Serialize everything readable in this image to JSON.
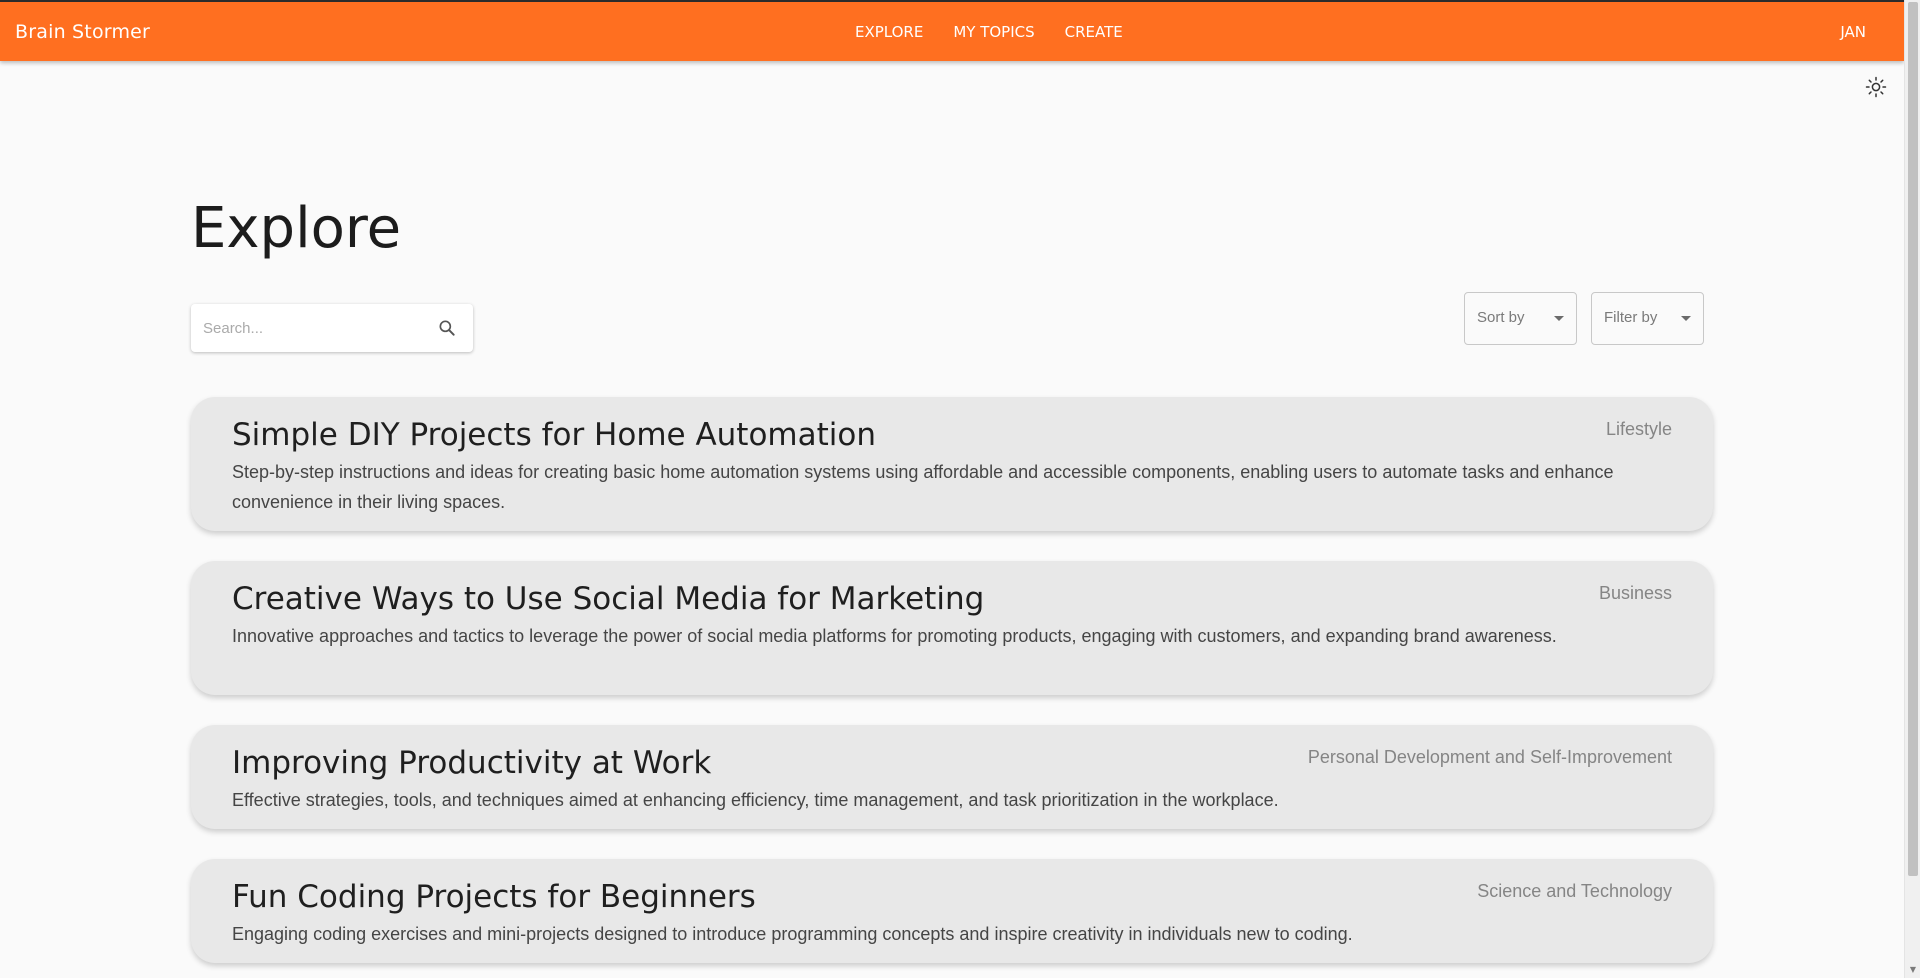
{
  "header": {
    "brand": "Brain Stormer",
    "nav": [
      "EXPLORE",
      "MY TOPICS",
      "CREATE"
    ],
    "user": "JAN",
    "color": "#ff6f20"
  },
  "theme_toggle_icon": "sun-icon",
  "main": {
    "title": "Explore",
    "search": {
      "placeholder": "Search...",
      "value": ""
    },
    "sort": {
      "label": "Sort by"
    },
    "filter": {
      "label": "Filter by"
    },
    "topics": [
      {
        "title": "Simple DIY Projects for Home Automation",
        "category": "Lifestyle",
        "description": "Step-by-step instructions and ideas for creating basic home automation systems using affordable and accessible components, enabling users to automate tasks and enhance convenience in their living spaces."
      },
      {
        "title": "Creative Ways to Use Social Media for Marketing",
        "category": "Business",
        "description": "Innovative approaches and tactics to leverage the power of social media platforms for promoting products, engaging with customers, and expanding brand awareness."
      },
      {
        "title": "Improving Productivity at Work",
        "category": "Personal Development and Self-Improvement",
        "description": "Effective strategies, tools, and techniques aimed at enhancing efficiency, time management, and task prioritization in the workplace."
      },
      {
        "title": "Fun Coding Projects for Beginners",
        "category": "Science and Technology",
        "description": "Engaging coding exercises and mini-projects designed to introduce programming concepts and inspire creativity in individuals new to coding."
      }
    ]
  }
}
